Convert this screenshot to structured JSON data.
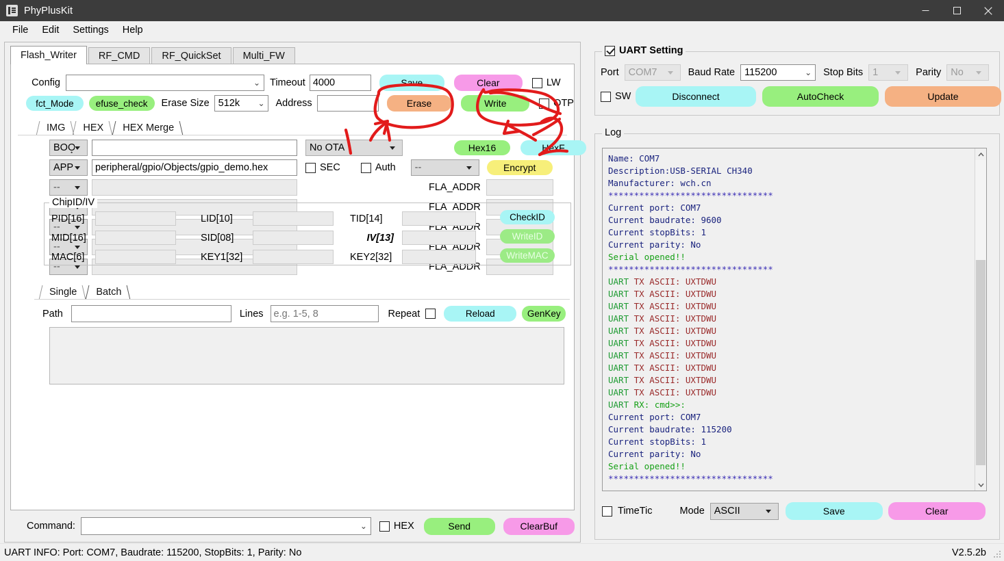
{
  "window": {
    "title": "PhyPlusKit",
    "icon": "app-icon",
    "minimize": "—",
    "maximize": "□",
    "close": "✕"
  },
  "menubar": {
    "items": [
      "File",
      "Edit",
      "Settings",
      "Help"
    ]
  },
  "main_tabs": [
    {
      "label": "Flash_Writer",
      "active": true
    },
    {
      "label": "RF_CMD",
      "active": false
    },
    {
      "label": "RF_QuickSet",
      "active": false
    },
    {
      "label": "Multi_FW",
      "active": false
    }
  ],
  "flash_writer": {
    "config_label": "Config",
    "config_value": "",
    "timeout_label": "Timeout",
    "timeout_value": "4000",
    "save_button": "Save",
    "clear_button": "Clear",
    "lw_checkbox": "LW",
    "lw_checked": false,
    "fct_mode_pill": "fct_Mode",
    "efuse_check_pill": "efuse_check",
    "erase_size_label": "Erase Size",
    "erase_size_value": "512k",
    "address_label": "Address",
    "address_value": "",
    "erase_button": "Erase",
    "write_button": "Write",
    "otp_checkbox": "OTP",
    "otp_checked": false
  },
  "hex_tabs": [
    {
      "label": "IMG",
      "active": false
    },
    {
      "label": "HEX",
      "active": false
    },
    {
      "label": "HEX Merge",
      "active": true
    }
  ],
  "hex_merge": {
    "rows": [
      {
        "type": "BOO͙",
        "path": "",
        "disabled": false
      },
      {
        "type": "APP",
        "path": "peripheral/gpio/Objects/gpio_demo.hex",
        "disabled": false
      },
      {
        "type": "--",
        "path": "",
        "disabled": true
      },
      {
        "type": "--",
        "path": "",
        "disabled": true
      },
      {
        "type": "--",
        "path": "",
        "disabled": true
      },
      {
        "type": "--",
        "path": "",
        "disabled": true
      },
      {
        "type": "--",
        "path": "",
        "disabled": true
      }
    ],
    "ota_value": "No OTA",
    "sec_checkbox": "SEC",
    "sec_checked": false,
    "auth_checkbox": "Auth",
    "auth_checked": false,
    "hex16_button": "Hex16",
    "hexf_button": "HexF",
    "encrypt_select": "--",
    "encrypt_button": "Encrypt",
    "fla_addr_label": "FLA_ADDR",
    "fla_addr_rows": [
      "",
      "",
      "",
      "",
      ""
    ]
  },
  "chipid": {
    "group_title": "ChipID/IV",
    "fields": [
      {
        "label": "PID[16]",
        "value": ""
      },
      {
        "label": "LID[10]",
        "value": ""
      },
      {
        "label": "TID[14]",
        "value": ""
      },
      {
        "label": "MID[16]",
        "value": ""
      },
      {
        "label": "SID[08]",
        "value": ""
      },
      {
        "label": "IV[13]",
        "value": "",
        "emphasis": true
      },
      {
        "label": "MAC[6]",
        "value": ""
      },
      {
        "label": "KEY1[32]",
        "value": ""
      },
      {
        "label": "KEY2[32]",
        "value": ""
      }
    ],
    "check_id_button": "CheckID",
    "write_id_button": "WriteID",
    "write_mac_button": "WriteMAC"
  },
  "batch_tabs": [
    {
      "label": "Single",
      "active": false
    },
    {
      "label": "Batch",
      "active": true
    }
  ],
  "batch": {
    "path_label": "Path",
    "path_value": "",
    "lines_label": "Lines",
    "lines_placeholder": "e.g. 1-5, 8",
    "lines_value": "",
    "repeat_label": "Repeat",
    "repeat_checked": false,
    "reload_button": "Reload",
    "genkey_button": "GenKey",
    "textarea_value": ""
  },
  "command_bar": {
    "label": "Command:",
    "value": "",
    "hex_checkbox": "HEX",
    "hex_checked": false,
    "send_button": "Send",
    "clearbuf_button": "ClearBuf"
  },
  "uart_setting": {
    "title": "UART Setting",
    "enabled": true,
    "port_label": "Port",
    "port_value": "COM7",
    "port_disabled": true,
    "baud_label": "Baud Rate",
    "baud_value": "115200",
    "stopbits_label": "Stop Bits",
    "stopbits_value": "1",
    "stopbits_disabled": true,
    "parity_label": "Parity",
    "parity_value": "No",
    "parity_disabled": true,
    "sw_checkbox": "SW",
    "sw_checked": false,
    "disconnect_button": "Disconnect",
    "autocheck_button": "AutoCheck",
    "update_button": "Update"
  },
  "log": {
    "title": "Log",
    "lines": [
      {
        "text": "Name: COM7",
        "style": "blue"
      },
      {
        "text": "Description:USB-SERIAL CH340",
        "style": "blue"
      },
      {
        "text": "Manufacturer: wch.cn",
        "style": "blue"
      },
      {
        "text": "********************************",
        "style": "star"
      },
      {
        "text": "Current port: COM7",
        "style": "blue"
      },
      {
        "text": "Current baudrate: 9600",
        "style": "blue"
      },
      {
        "text": "Current stopBits: 1",
        "style": "blue"
      },
      {
        "text": "Current parity: No",
        "style": "blue"
      },
      {
        "text": "Serial opened!!",
        "style": "green"
      },
      {
        "text": "********************************",
        "style": "star"
      },
      {
        "prefix": "UART ",
        "text": "TX ASCII: UXTDWU",
        "style": "tx"
      },
      {
        "prefix": "UART ",
        "text": "TX ASCII: UXTDWU",
        "style": "tx"
      },
      {
        "prefix": "UART ",
        "text": "TX ASCII: UXTDWU",
        "style": "tx"
      },
      {
        "prefix": "UART ",
        "text": "TX ASCII: UXTDWU",
        "style": "tx"
      },
      {
        "prefix": "UART ",
        "text": "TX ASCII: UXTDWU",
        "style": "tx"
      },
      {
        "prefix": "UART ",
        "text": "TX ASCII: UXTDWU",
        "style": "tx"
      },
      {
        "prefix": "UART ",
        "text": "TX ASCII: UXTDWU",
        "style": "tx"
      },
      {
        "prefix": "UART ",
        "text": "TX ASCII: UXTDWU",
        "style": "tx"
      },
      {
        "prefix": "UART ",
        "text": "TX ASCII: UXTDWU",
        "style": "tx"
      },
      {
        "prefix": "UART ",
        "text": "TX ASCII: UXTDWU",
        "style": "tx"
      },
      {
        "prefix": "UART ",
        "text": "RX: cmd>>:",
        "style": "rx"
      },
      {
        "text": "Current port: COM7",
        "style": "blue"
      },
      {
        "text": "Current baudrate: 115200",
        "style": "blue"
      },
      {
        "text": "Current stopBits: 1",
        "style": "blue"
      },
      {
        "text": "Current parity: No",
        "style": "blue"
      },
      {
        "text": "Serial opened!!",
        "style": "green"
      },
      {
        "text": "********************************",
        "style": "star"
      }
    ],
    "timetic_checkbox": "TimeTic",
    "timetic_checked": false,
    "mode_label": "Mode",
    "mode_value": "ASCII",
    "save_button": "Save",
    "clear_button": "Clear"
  },
  "statusbar": {
    "info": "UART INFO: Port: COM7, Baudrate: 115200, StopBits: 1, Parity: No",
    "version": "V2.5.2b"
  },
  "colors": {
    "cyan": "#a8f5f5",
    "magenta": "#f79ae8",
    "orange": "#f5b183",
    "green": "#98ef7e",
    "yellow": "#f7ef7a",
    "annotation_red": "#e21b1b",
    "titlebar": "#3c3c3c"
  },
  "annotations": {
    "description": "hand-drawn red marker: circles around Erase and Write buttons, arrows pointing up at them, and a stroke near HexF"
  }
}
